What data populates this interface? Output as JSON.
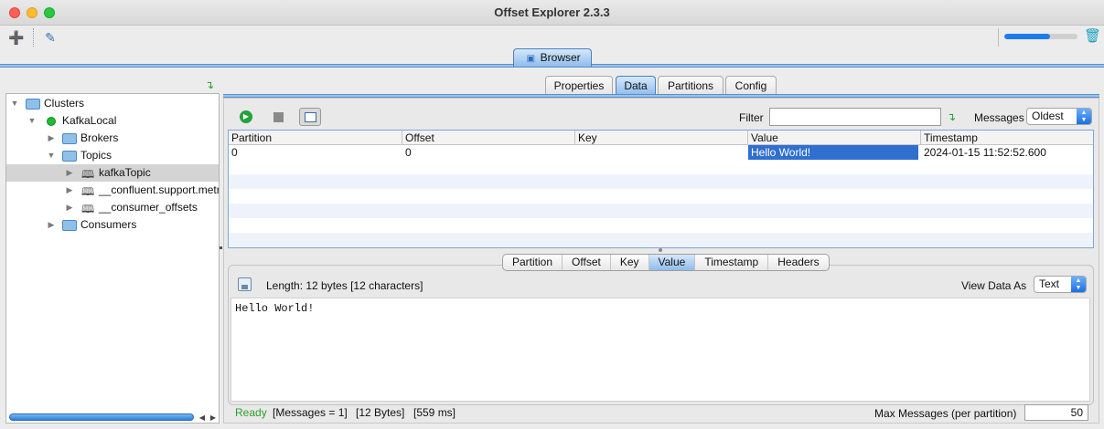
{
  "window": {
    "title": "Offset Explorer  2.3.3"
  },
  "toolbar": {
    "icons": [
      "add-connection-icon",
      "edit-settings-icon",
      "trash-icon"
    ],
    "progress_percent": 62
  },
  "main_tab": {
    "label": "Browser"
  },
  "tree": {
    "items": [
      {
        "label": "Clusters",
        "type": "folder",
        "expanded": true
      },
      {
        "label": "KafkaLocal",
        "type": "cluster",
        "status": "connected"
      },
      {
        "label": "Brokers",
        "type": "folder"
      },
      {
        "label": "Topics",
        "type": "folder",
        "expanded": true
      },
      {
        "label": "kafkaTopic",
        "type": "topic",
        "selected": true
      },
      {
        "label": "__confluent.support.metrics",
        "type": "topic"
      },
      {
        "label": "__consumer_offsets",
        "type": "topic"
      },
      {
        "label": "Consumers",
        "type": "folder"
      }
    ]
  },
  "tabs": [
    {
      "label": "Properties"
    },
    {
      "label": "Data",
      "active": true
    },
    {
      "label": "Partitions"
    },
    {
      "label": "Config"
    }
  ],
  "data_toolbar": {
    "filter_label": "Filter",
    "filter_value": "",
    "messages_label": "Messages",
    "messages_value": "Oldest"
  },
  "table": {
    "columns": [
      "Partition",
      "Offset",
      "Key",
      "Value",
      "Timestamp"
    ],
    "rows": [
      {
        "partition": "0",
        "offset": "0",
        "key": "",
        "value": "Hello World!",
        "timestamp": "2024-01-15 11:52:52.600"
      }
    ]
  },
  "detail": {
    "tabs": [
      {
        "label": "Partition"
      },
      {
        "label": "Offset"
      },
      {
        "label": "Key"
      },
      {
        "label": "Value",
        "active": true
      },
      {
        "label": "Timestamp"
      },
      {
        "label": "Headers"
      }
    ],
    "length_text": "Length: 12 bytes [12 characters]",
    "view_as_label": "View Data As",
    "view_as_value": "Text",
    "content": "Hello World!"
  },
  "status": {
    "state": "Ready",
    "messages": "[Messages = 1]",
    "bytes": "[12 Bytes]",
    "time": "[559 ms]",
    "max_label": "Max Messages (per partition)",
    "max_value": "50"
  },
  "colors": {
    "accent": "#2f6fd0",
    "ready": "#27a127",
    "tab_blue": "#8fbcec"
  }
}
